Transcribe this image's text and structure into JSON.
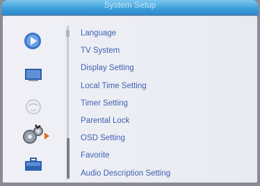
{
  "header": {
    "title": "System Setup"
  },
  "sidebar": {
    "icons": [
      "play-icon",
      "display-icon",
      "globe-icon",
      "settings-icon",
      "briefcase-icon"
    ]
  },
  "menu": {
    "items": [
      "Language",
      "TV System",
      "Display Setting",
      "Local Time Setting",
      "Timer Setting",
      "Parental Lock",
      "OSD Setting",
      "Favorite",
      "Audio Description Setting"
    ]
  }
}
